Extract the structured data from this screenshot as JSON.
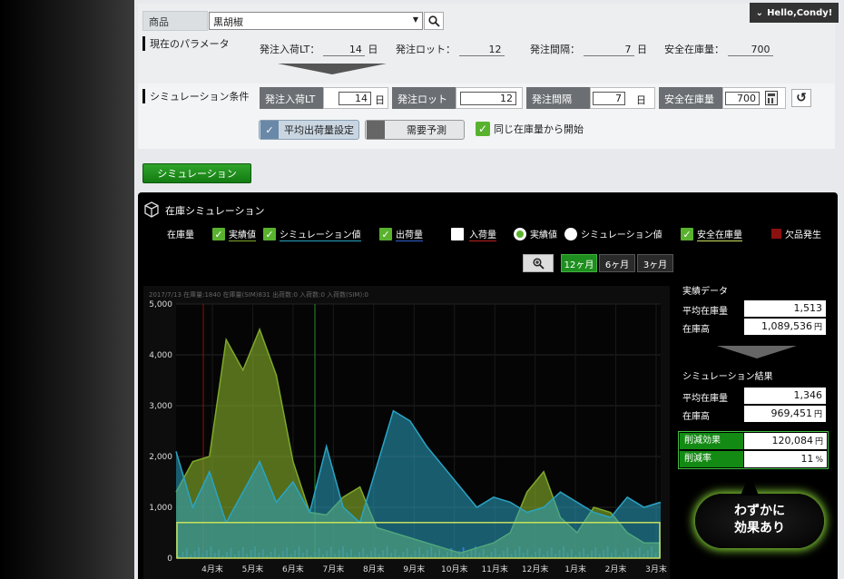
{
  "header": {
    "product_label": "商品",
    "product_value": "黒胡椒",
    "user_greeting": "Hello,Condy!"
  },
  "current_params": {
    "section_title": "現在のパラメータ",
    "items": [
      {
        "label": "発注入荷LT：",
        "value": "14",
        "unit": "日"
      },
      {
        "label": "発注ロット：",
        "value": "12",
        "unit": ""
      },
      {
        "label": "発注間隔：",
        "value": "7",
        "unit": "日"
      },
      {
        "label": "安全在庫量：",
        "value": "700",
        "unit": ""
      }
    ]
  },
  "sim_conditions": {
    "section_title": "シミュレーション条件",
    "fields": [
      {
        "label": "発注入荷LT",
        "value": "14",
        "unit": "日"
      },
      {
        "label": "発注ロット",
        "value": "12",
        "unit": ""
      },
      {
        "label": "発注間隔",
        "value": "7",
        "unit": "日"
      },
      {
        "label": "安全在庫量",
        "value": "700",
        "unit": ""
      }
    ],
    "toggle_avg": "平均出荷量設定",
    "toggle_forecast": "需要予測",
    "same_stock_label": "同じ在庫量から開始"
  },
  "simulate_button": "シミュレーション",
  "inventory_panel": {
    "title": "在庫シミュレーション",
    "legend": {
      "stock_label": "在庫量",
      "actual": "実績値",
      "simulation": "シミュレーション値",
      "shipment": "出荷量",
      "arrival": "入荷量",
      "radio_actual": "実績値",
      "radio_simulation": "シミュレーション値",
      "safety_stock": "安全在庫量",
      "stockout": "欠品発生"
    },
    "range_buttons": [
      "12ヶ月",
      "6ヶ月",
      "3ヶ月"
    ],
    "active_range": "12ヶ月",
    "tooltip_text": "2017/7/13 在庫量:1840 在庫量(SIM)831 出荷数:0 入荷数:0 入荷数(SIM):0"
  },
  "actual_data": {
    "title": "実績データ",
    "avg_stock_label": "平均在庫量",
    "avg_stock_value": "1,513",
    "stock_amount_label": "在庫高",
    "stock_amount_value": "1,089,536",
    "yen": "円"
  },
  "sim_result": {
    "title": "シミュレーション結果",
    "avg_stock_label": "平均在庫量",
    "avg_stock_value": "1,346",
    "stock_amount_label": "在庫高",
    "stock_amount_value": "969,451",
    "reduction_label": "削減効果",
    "reduction_value": "120,084",
    "rate_label": "削減率",
    "rate_value": "11",
    "yen": "円",
    "pct": "%"
  },
  "callout": {
    "line1": "わずかに",
    "line2": "効果あり"
  },
  "chart_data": {
    "type": "area",
    "ylim": [
      0,
      5000
    ],
    "y_ticks": [
      "0",
      "1,000",
      "2,000",
      "3,000",
      "4,000",
      "5,000"
    ],
    "x_ticks": [
      "4月末",
      "5月末",
      "6月末",
      "7月末",
      "8月末",
      "9月末",
      "10月末",
      "11月末",
      "12月末",
      "1月末",
      "2月末",
      "3月末"
    ],
    "safety_stock": 700,
    "series": [
      {
        "name": "実績値",
        "color": "#7fa82a",
        "values": [
          1300,
          1900,
          2000,
          4300,
          3700,
          4500,
          3600,
          1900,
          900,
          850,
          1200,
          1400,
          600,
          500,
          400,
          300,
          200,
          100,
          200,
          300,
          500,
          1300,
          1700,
          800,
          500,
          1000,
          900,
          500,
          300,
          300
        ]
      },
      {
        "name": "シミュレーション値",
        "color": "#2aa4c4",
        "values": [
          2100,
          1000,
          1700,
          700,
          1300,
          1900,
          1100,
          1500,
          900,
          2200,
          1000,
          700,
          1800,
          2900,
          2700,
          2200,
          1800,
          1400,
          1000,
          1200,
          1100,
          900,
          1000,
          1300,
          1100,
          900,
          800,
          1200,
          1000,
          1100
        ]
      }
    ]
  }
}
